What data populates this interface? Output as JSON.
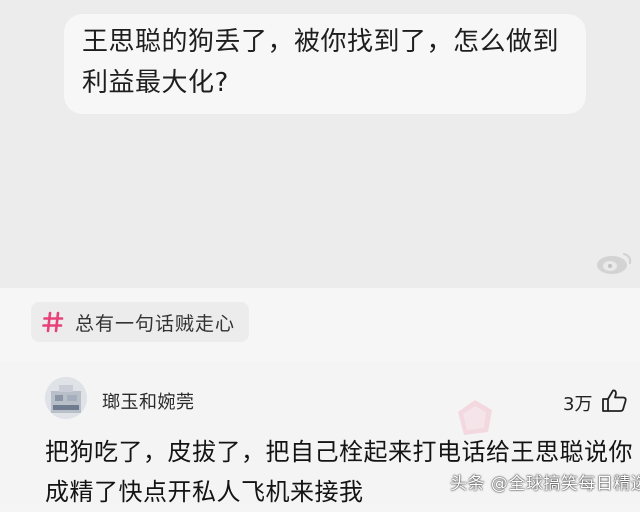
{
  "question": {
    "text": "王思聪的狗丢了，被你找到了，怎么做到利益最大化?"
  },
  "topic": {
    "label": "总有一句话贼走心",
    "icon": "hash-icon",
    "accent": "#e8417a"
  },
  "comment": {
    "username": "瑯玉和婉莞",
    "like_count": "3万",
    "text": "把狗吃了，皮拔了，把自己栓起来打电话给王思聪说你成精了快点开私人飞机来接我"
  },
  "watermark": {
    "source": "头条 @全球搞笑每日精选"
  },
  "colors": {
    "page_bg": "#f5f5f5",
    "question_area_bg": "#ececec",
    "bubble_bg": "#f7f7f7",
    "chip_bg": "#ececec"
  }
}
